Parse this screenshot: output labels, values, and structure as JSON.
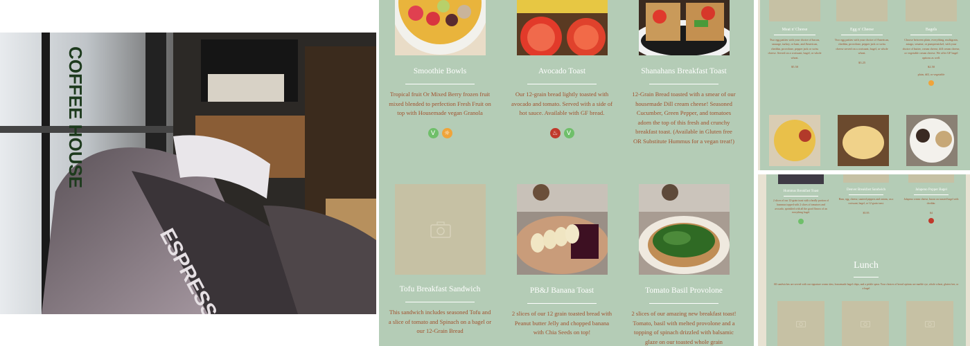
{
  "photo": {
    "alt_words": [
      "ESPRESSO",
      "COFFEE HOUSE",
      "ESPRESSO"
    ]
  },
  "menu": {
    "items": [
      {
        "title": "Smoothie Bowls",
        "desc": "Tropical fruit Or Mixed Berry frozen fruit mixed blended to perfection Fresh Fruit on top with Housemade vegan Granola",
        "badges": [
          "V",
          "☼"
        ]
      },
      {
        "title": "Avocado Toast",
        "desc": "Our 12-grain bread lightly toasted with avocado and tomato. Served with a side of hot sauce. Available with GF bread.",
        "badges": [
          "♨",
          "V"
        ]
      },
      {
        "title": "Shanahans Breakfast Toast",
        "desc": "12-Grain Bread toasted with a smear of our housemade Dill cream cheese! Seasoned Cucumber, Green Pepper, and tomatoes adorn the top of this fresh and crunchy breakfast toast. (Available in Gluten free OR Substitute Hummus for a vegan treat!)",
        "badges": []
      },
      {
        "title": "Tofu Breakfast Sandwich",
        "desc": "This sandwich includes seasoned Tofu and a slice of tomato and Spinach on a bagel or our 12-Grain Bread",
        "badges": []
      },
      {
        "title": "PB&J Banana Toast",
        "desc": "2 slices of our 12 grain toasted bread with Peanut butter Jelly and chopped banana with Chia Seeds on top!",
        "badges": []
      },
      {
        "title": "Tomato Basil Provolone",
        "desc": "2 slices of our amazing new breakfast toast! Tomato, basil with melted provolone and a topping of spinach drizzled with balsamic glaze on our toasted whole grain",
        "badges": []
      }
    ]
  },
  "mini_top": {
    "items": [
      {
        "title": "Meat n' Cheese",
        "desc": "Two egg patties with your choice of bacon, sausage, turkey, or ham, and American, cheddar, provolone, pepper jack or swiss cheese. Served on a croissant, bagel, or whole wheat.",
        "price": "$5.50"
      },
      {
        "title": "Egg n' Cheese",
        "desc": "Two egg patties with your choice of American, cheddar, provolone, pepper jack or swiss cheese served on a croissant, bagel, or whole wheat.",
        "price": "$3.25"
      },
      {
        "title": "Bagels",
        "desc": "Choose between plain, everything, multigrain, asiago, sesame, or pumpernickel, with your choice of butter, cream cheese, dill cream cheese, or vegetable cream cheese. We offer GF bagel options as well.",
        "price": "$2.50",
        "extra": "plain, dill, or vegetable"
      }
    ]
  },
  "mini_bot": {
    "items": [
      {
        "title": "Hummus Breakfast Toast",
        "desc": "2 slices of our 12-grain toast with a heally portion of hummus topped with 2 slices of tomatoes and avocado, sprinkled with all the good flavors of an everything bagel."
      },
      {
        "title": "Denver Breakfast Sandwich",
        "desc": "Ham, egg, cheese, sauteed peppers and onions, on a croissant, bagel, or 12-grain toast.",
        "price": "$5.95"
      },
      {
        "title": "Jalapeno Popper Bagel",
        "desc": "Jalapeno cream cheese, bacon on toasted bagel with cheddar.",
        "price": "$4"
      }
    ],
    "lunch_title": "Lunch",
    "lunch_note": "All sandwiches are served with our signature cream slaw, housemade bagel chips, and a pickle spear. Your choices of bread options are marble rye, whole wheat, gluten free, or a bagel"
  },
  "colors": {
    "bg": "#b4ccb6",
    "text": "#a0502c",
    "green": "#6fbf6a",
    "orange": "#f0a43a",
    "red": "#c0392b"
  }
}
